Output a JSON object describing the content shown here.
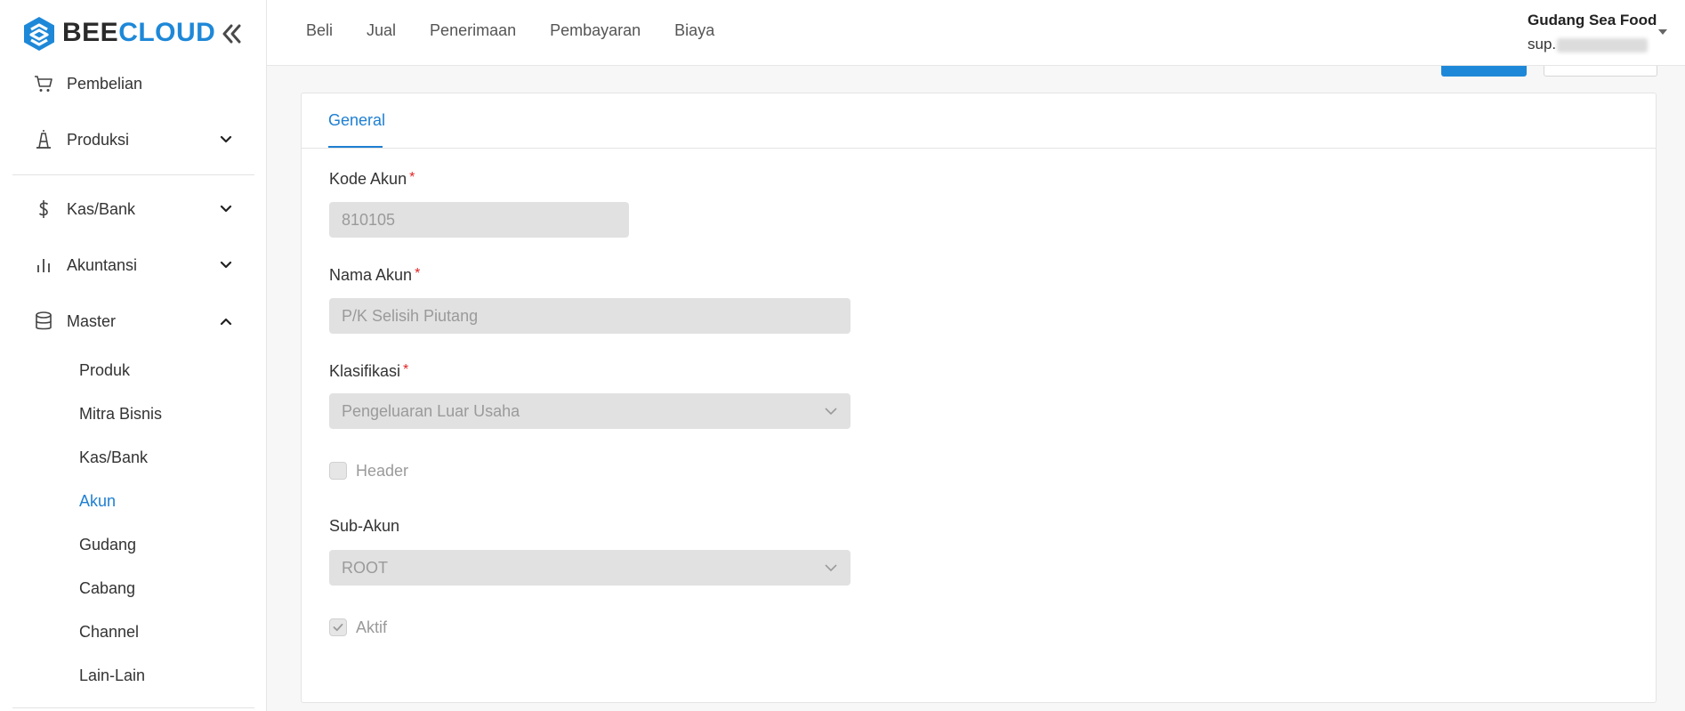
{
  "brand": {
    "part1": "BEE",
    "part2": "CLOUD"
  },
  "sidebar": {
    "items": [
      {
        "label": "Pembelian"
      },
      {
        "label": "Produksi"
      },
      {
        "label": "Kas/Bank"
      },
      {
        "label": "Akuntansi"
      },
      {
        "label": "Master"
      }
    ],
    "master_sub": [
      {
        "label": "Produk"
      },
      {
        "label": "Mitra Bisnis"
      },
      {
        "label": "Kas/Bank"
      },
      {
        "label": "Akun"
      },
      {
        "label": "Gudang"
      },
      {
        "label": "Cabang"
      },
      {
        "label": "Channel"
      },
      {
        "label": "Lain-Lain"
      }
    ]
  },
  "topnav": [
    "Beli",
    "Jual",
    "Penerimaan",
    "Pembayaran",
    "Biaya"
  ],
  "user": {
    "company": "Gudang Sea Food",
    "email_visible": "sup."
  },
  "tabs": {
    "general": "General"
  },
  "form": {
    "kode_akun": {
      "label": "Kode Akun",
      "value": "810105"
    },
    "nama_akun": {
      "label": "Nama Akun",
      "value": "P/K Selisih Piutang"
    },
    "klasifikasi": {
      "label": "Klasifikasi",
      "value": "Pengeluaran Luar Usaha"
    },
    "header": {
      "label": "Header",
      "checked": false
    },
    "sub_akun": {
      "label": "Sub-Akun",
      "value": "ROOT"
    },
    "aktif": {
      "label": "Aktif",
      "checked": true
    },
    "required_mark": "*"
  },
  "colors": {
    "accent": "#1e7fd2",
    "brand_blue": "#1e88d8",
    "required": "#e02424"
  }
}
